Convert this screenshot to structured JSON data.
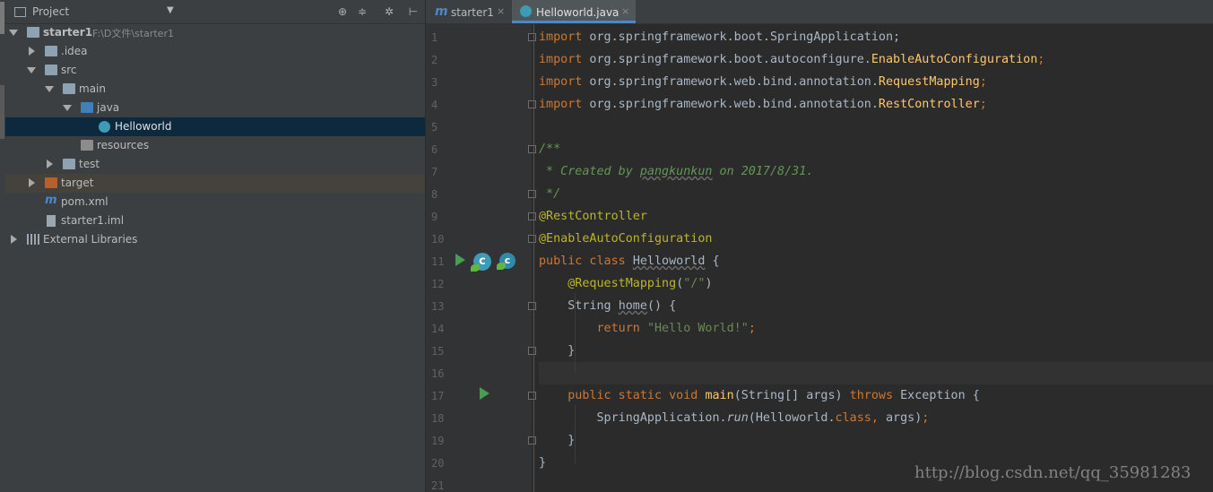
{
  "project_panel": {
    "title": "Project",
    "toolbar_icons": [
      "target-icon",
      "collapse-icon",
      "gear-icon",
      "hide-icon"
    ],
    "tree": [
      {
        "label": "starter1",
        "sub": "F:\\D文件\\starter1",
        "icon": "module-folder-icon",
        "expanded": true
      },
      {
        "label": ".idea",
        "icon": "folder-icon",
        "expanded": false
      },
      {
        "label": "src",
        "icon": "folder-icon",
        "expanded": true
      },
      {
        "label": "main",
        "icon": "folder-icon",
        "expanded": true
      },
      {
        "label": "java",
        "icon": "source-folder-icon",
        "expanded": true
      },
      {
        "label": "Helloworld",
        "icon": "spring-class-icon",
        "selected": true
      },
      {
        "label": "resources",
        "icon": "resources-folder-icon"
      },
      {
        "label": "test",
        "icon": "folder-icon",
        "expanded": false
      },
      {
        "label": "target",
        "icon": "excluded-folder-icon",
        "expanded": false,
        "highlighted": true
      },
      {
        "label": "pom.xml",
        "icon": "maven-icon"
      },
      {
        "label": "starter1.iml",
        "icon": "iml-file-icon"
      },
      {
        "label": "External Libraries",
        "icon": "libraries-icon",
        "expanded": false
      }
    ]
  },
  "editor": {
    "tabs": [
      {
        "label": "starter1",
        "icon": "maven-icon",
        "close": "×",
        "active": false
      },
      {
        "label": "Helloworld.java",
        "icon": "spring-class-icon",
        "close": "×",
        "active": true
      }
    ],
    "line_numbers": [
      "1",
      "2",
      "3",
      "4",
      "5",
      "6",
      "7",
      "8",
      "9",
      "10",
      "11",
      "12",
      "13",
      "14",
      "15",
      "16",
      "17",
      "18",
      "19",
      "20",
      "21"
    ],
    "code": {
      "l1": {
        "kw": "import",
        "pkg": " org.springframework.boot.SpringApplication;"
      },
      "l2": {
        "kw": "import",
        "pkg": " org.springframework.boot.autoconfigure.",
        "hl": "EnableAutoConfiguration",
        "end": ";"
      },
      "l3": {
        "kw": "import",
        "pkg": " org.springframework.web.bind.annotation.",
        "hl": "RequestMapping",
        "end": ";"
      },
      "l4": {
        "kw": "import",
        "pkg": " org.springframework.web.bind.annotation.",
        "hl": "RestController",
        "end": ";"
      },
      "l6": "/**",
      "l7a": " * Created by ",
      "l7b": "pangkunkun",
      "l7c": " on 2017/8/31.",
      "l8": " */",
      "l9": "@RestController",
      "l10": "@EnableAutoConfiguration",
      "l11a": "public class ",
      "l11b": "Helloworld",
      "l11c": " {",
      "l12a": "    ",
      "l12b": "@RequestMapping",
      "l12c": "(",
      "l12d": "\"/\"",
      "l12e": ")",
      "l13a": "    String ",
      "l13b": "home",
      "l13c": "() {",
      "l14a": "        ",
      "l14b": "return ",
      "l14c": "\"Hello World!\"",
      "l14d": ";",
      "l15": "    }",
      "l17a": "    ",
      "l17b": "public static void ",
      "l17c": "main",
      "l17d": "(String[] args) ",
      "l17e": "throws ",
      "l17f": "Exception {",
      "l18a": "        SpringApplication.",
      "l18b": "run",
      "l18c": "(Helloworld.",
      "l18d": "class, ",
      "l18e": "args)",
      "l18f": ";",
      "l19": "    }",
      "l20": "}"
    }
  },
  "watermark": "http://blog.csdn.net/qq_35981283",
  "colors": {
    "keyword": "#cc7832",
    "annotation": "#bbb529",
    "string": "#6a8759",
    "comment": "#629755",
    "method": "#ffc66d",
    "text": "#a9b7c6",
    "selection": "#0d293e"
  }
}
